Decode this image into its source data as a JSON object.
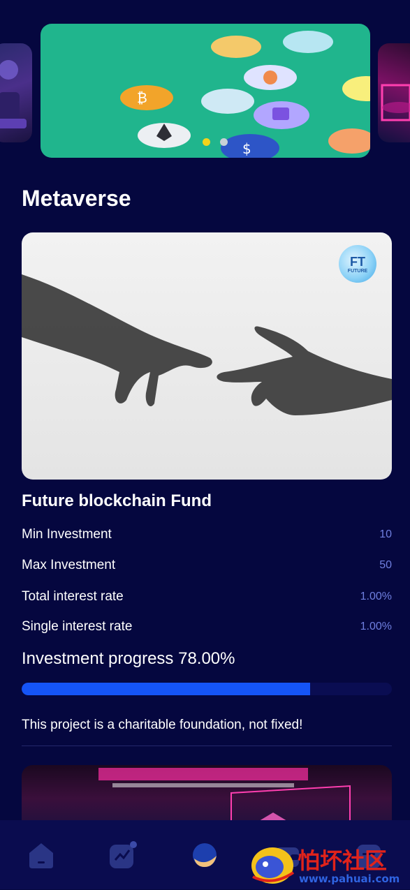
{
  "carousel": {
    "slides": [
      "metaverse-banner",
      "crypto-coins-banner",
      "neon-banner"
    ],
    "active_index": 0,
    "indicator_count": 2
  },
  "section": {
    "title": "Metaverse"
  },
  "fund": {
    "logo_text": "FT",
    "logo_subtext": "FUTURE",
    "title": "Future blockchain Fund",
    "rows": [
      {
        "label": "Min Investment",
        "value": "10"
      },
      {
        "label": "Max Investment",
        "value": "50"
      },
      {
        "label": "Total interest rate",
        "value": "1.00%"
      },
      {
        "label": "Single interest rate",
        "value": "1.00%"
      }
    ],
    "progress_label": "Investment progress 78.00%",
    "progress": 0.78,
    "note": "This project is a charitable foundation, not fixed!"
  },
  "tabbar": {
    "items": [
      {
        "icon": "home-icon",
        "active": false
      },
      {
        "icon": "trend-chart-icon",
        "active": false
      },
      {
        "icon": "planet-icon",
        "active": true
      },
      {
        "icon": "wallet-icon",
        "active": false
      },
      {
        "icon": "profile-icon",
        "active": false
      }
    ]
  },
  "watermark": {
    "text": "怕坏社区",
    "url_text": "www.pahuai.com"
  },
  "colors": {
    "background": "#05073f",
    "accent_value": "#6f7fe0",
    "progress_fill": "#1554f6",
    "dot_active": "#f5d31a",
    "tabbar_bg": "#0a0c4f"
  }
}
